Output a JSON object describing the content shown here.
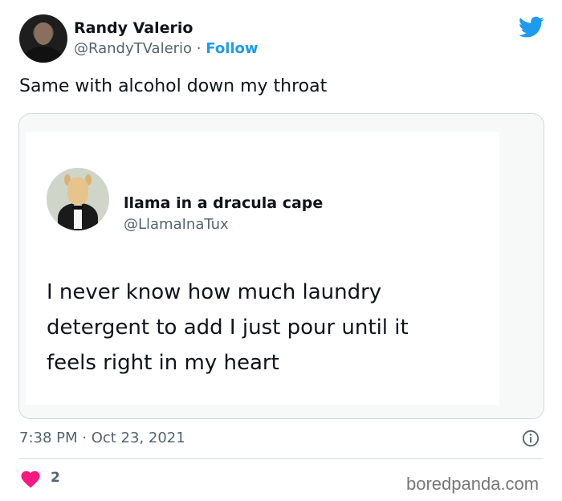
{
  "author": {
    "name": "Randy Valerio",
    "handle": "@RandyTValerio",
    "separator": "·",
    "follow_label": "Follow"
  },
  "tweet": {
    "text": "Same with alcohol down my throat",
    "timestamp": "7:38 PM · Oct 23, 2021",
    "likes": "2"
  },
  "quoted": {
    "name": "llama in a dracula cape",
    "handle": "@LlamaInaTux",
    "text": "I never know how much laundry detergent to add I just pour until it feels right in my heart"
  },
  "watermark": "boredpanda.com",
  "colors": {
    "accent": "#1d9bf0",
    "heart": "#f91880",
    "muted": "#536471",
    "text": "#0f1419"
  },
  "icons": [
    "twitter-bird-icon",
    "info-icon",
    "heart-icon"
  ]
}
